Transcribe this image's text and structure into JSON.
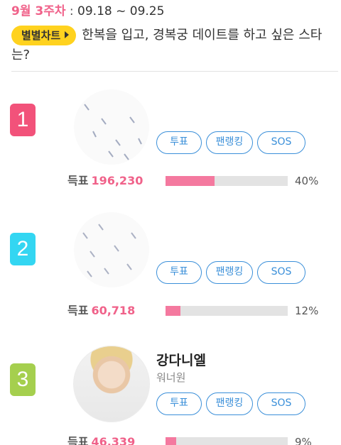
{
  "header": {
    "week": "9월 3주차",
    "separator": " : ",
    "range": "09.18 ~ 09.25"
  },
  "badge_label": "별별차트",
  "question": "한복을 입고, 경복궁 데이트를 하고 싶은 스타는?",
  "buttons": {
    "vote": "투표",
    "fan": "팬랭킹",
    "sos": "SOS"
  },
  "vote_prefix": "득표",
  "rank_colors": [
    "#f2527a",
    "#33d6f2",
    "#a5cf4e"
  ],
  "accent": "#f0628a",
  "button_color": "#3a8fd9",
  "ranks": [
    {
      "rank": "1",
      "name": "",
      "group": "",
      "votes": "196,230",
      "percent": "40%",
      "fill": 0.4
    },
    {
      "rank": "2",
      "name": "",
      "group": "",
      "votes": "60,718",
      "percent": "12%",
      "fill": 0.12
    },
    {
      "rank": "3",
      "name": "강다니엘",
      "group": "워너원",
      "votes": "46,339",
      "percent": "9%",
      "fill": 0.09
    }
  ]
}
